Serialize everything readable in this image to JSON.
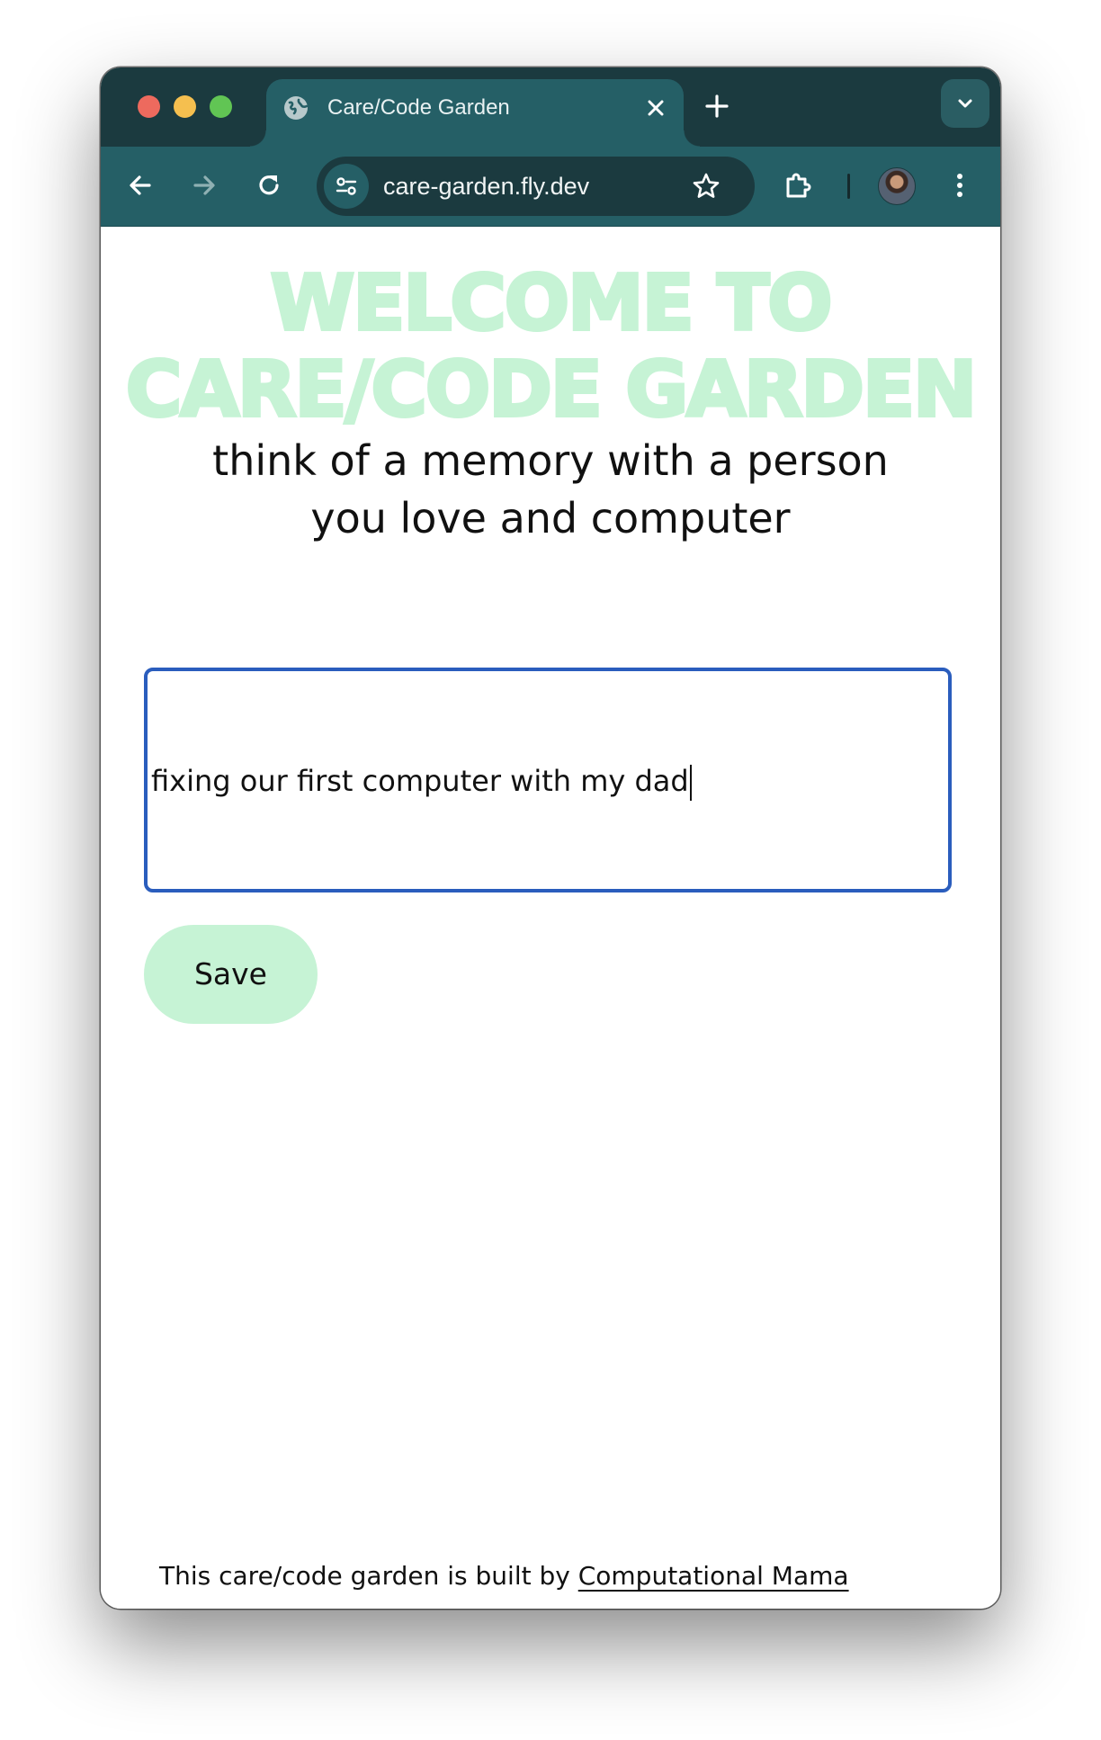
{
  "browser": {
    "tab_title": "Care/Code Garden",
    "url": "care-garden.fly.dev",
    "icons": {
      "favicon": "globe-icon",
      "tab_close": "close-icon",
      "new_tab": "plus-icon",
      "tab_search": "chevron-down-icon",
      "back": "arrow-left-icon",
      "forward": "arrow-right-icon",
      "reload": "reload-icon",
      "site_info": "tune-icon",
      "bookmark": "star-icon",
      "extensions": "puzzle-icon",
      "profile": "avatar",
      "menu": "kebab-menu-icon"
    },
    "colors": {
      "frame": "#1b3a3f",
      "toolbar": "#255f66"
    }
  },
  "page": {
    "heading_line1": "WELCOME TO",
    "heading_line2": "CARE/CODE GARDEN",
    "prompt": "think of a memory with a person you love and computer",
    "memory_value": "fixing our first computer with my dad",
    "save_label": "Save",
    "footer_text": "This care/code garden is built by ",
    "footer_link": "Computational Mama",
    "colors": {
      "accent_mint": "#c6f3d5",
      "focus_border": "#2a5dbd"
    }
  }
}
